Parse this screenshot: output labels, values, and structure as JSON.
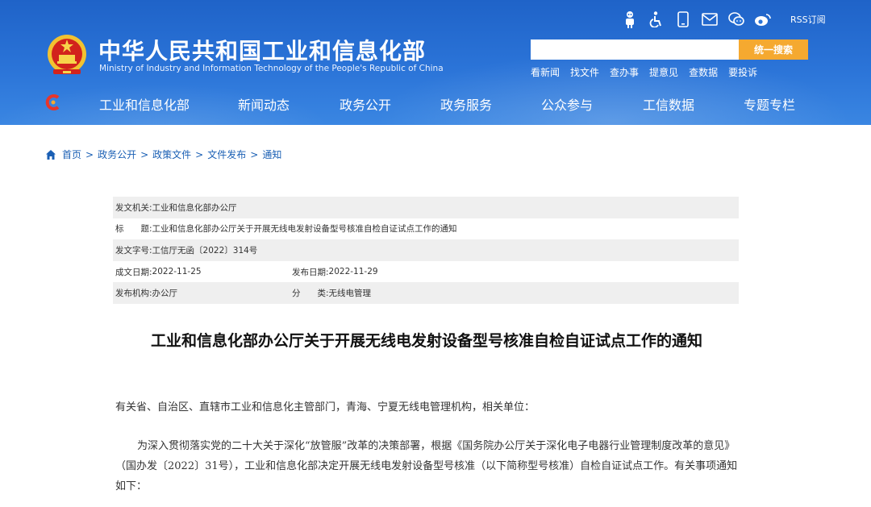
{
  "header": {
    "title": "中华人民共和国工业和信息化部",
    "subtitle": "Ministry of Industry and Information Technology of the People's Republic of China",
    "tools": {
      "rss_label": "RSS订阅"
    },
    "search": {
      "placeholder": "",
      "button_label": "统一搜索"
    },
    "quick_links": [
      "看新闻",
      "找文件",
      "查办事",
      "提意见",
      "查数据",
      "要投诉"
    ],
    "nav": [
      "工业和信息化部",
      "新闻动态",
      "政务公开",
      "政务服务",
      "公众参与",
      "工信数据",
      "专题专栏"
    ]
  },
  "breadcrumb": [
    "首页",
    "政务公开",
    "政策文件",
    "文件发布",
    "通知"
  ],
  "info": {
    "issuer_label": "发文机关:",
    "issuer": "工业和信息化部办公厅",
    "subject_label": "标　　题:",
    "subject": "工业和信息化部办公厅关于开展无线电发射设备型号核准自检自证试点工作的通知",
    "doc_no_label": "发文字号:",
    "doc_no": "工信厅无函〔2022〕314号",
    "created_label": "成文日期:",
    "created": "2022-11-25",
    "published_label": "发布日期:",
    "published": "2022-11-29",
    "publisher_label": "发布机构:",
    "publisher": "办公厅",
    "category_label": "分　　类:",
    "category": "无线电管理"
  },
  "article": {
    "title": "工业和信息化部办公厅关于开展无线电发射设备型号核准自检自证试点工作的通知",
    "recipients": "有关省、自治区、直辖市工业和信息化主管部门，青海、宁夏无线电管理机构，相关单位：",
    "paragraph1": "为深入贯彻落实党的二十大关于深化“放管服”改革的决策部署，根据《国务院办公厅关于深化电子电器行业管理制度改革的意见》（国办发〔2022〕31号），工业和信息化部决定开展无线电发射设备型号核准（以下简称型号核准）自检自证试点工作。有关事项通知如下："
  }
}
